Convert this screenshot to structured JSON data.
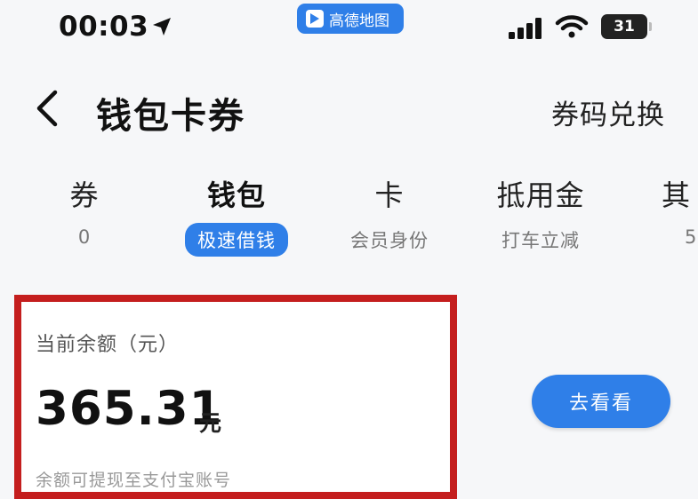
{
  "status_bar": {
    "time": "00:03",
    "battery": "31",
    "app_pill": "高德地图"
  },
  "header": {
    "title": "钱包卡券",
    "action": "券码兑换"
  },
  "tabs": [
    {
      "label": "券",
      "sub": "0"
    },
    {
      "label": "钱包",
      "sub": "极速借钱",
      "active": true
    },
    {
      "label": "卡",
      "sub": "会员身份"
    },
    {
      "label": "抵用金",
      "sub": "打车立减"
    },
    {
      "label": "其",
      "sub": "5"
    }
  ],
  "balance_card": {
    "label": "当前余额（元）",
    "amount": "365.31",
    "unit": "元",
    "note": "余额可提现至支付宝账号"
  },
  "view_button": {
    "label": "去看看"
  },
  "colors": {
    "accent": "#2f7fe8",
    "highlight_border": "#c41e1e",
    "background": "#f6f7f9"
  }
}
